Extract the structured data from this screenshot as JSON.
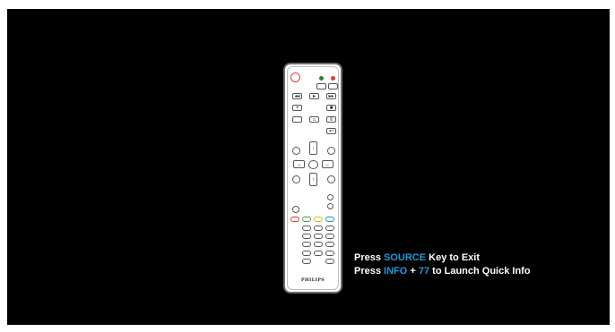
{
  "remote": {
    "brand": "PHILIPS",
    "colors": {
      "power_dot": "#e53935",
      "green_dot": "#2e7d32",
      "red_dot": "#e53935",
      "body": "#ffffff",
      "outline": "#6b6b6b"
    },
    "icons": [
      "power-icon",
      "rewind-icon",
      "play-icon",
      "fast-forward-icon",
      "stop-icon",
      "record-icon",
      "source-icon",
      "home-icon",
      "list-icon",
      "back-icon",
      "up-arrow-icon",
      "down-arrow-icon",
      "left-arrow-icon",
      "right-arrow-icon",
      "ok-icon"
    ]
  },
  "message": {
    "line1_prefix": "Press ",
    "line1_key": "SOURCE",
    "line1_suffix": " Key to Exit",
    "line2_prefix": "Press ",
    "line2_key1": "INFO",
    "line2_mid": " + ",
    "line2_key2": "77",
    "line2_suffix": " to Launch Quick Info",
    "highlight_color": "#1e9bd7"
  }
}
